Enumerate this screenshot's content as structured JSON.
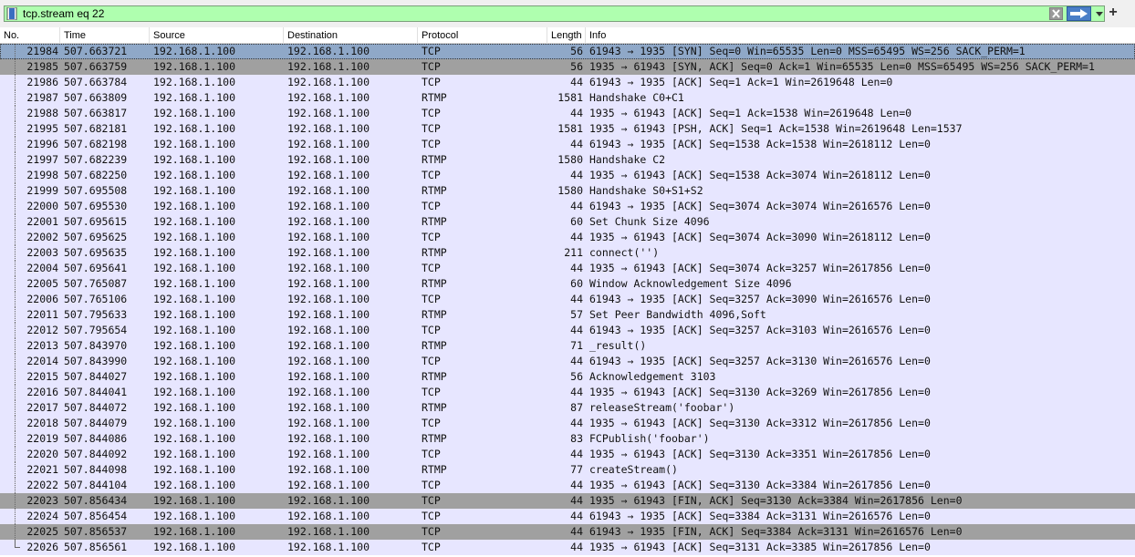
{
  "filter": {
    "value": "tcp.stream eq 22"
  },
  "toolbar": {
    "add_label": "+"
  },
  "columns": {
    "no": "No.",
    "time": "Time",
    "source": "Source",
    "destination": "Destination",
    "protocol": "Protocol",
    "length": "Length",
    "info": "Info"
  },
  "colors": {
    "selected": "#8fa8c8",
    "syn": "#a0a0a0",
    "fin": "#a0a0a0",
    "normal": "#e7e6ff",
    "filter_ok": "#afffaf"
  },
  "packets": [
    {
      "no": "21984",
      "time": "507.663721",
      "src": "192.168.1.100",
      "dst": "192.168.1.100",
      "proto": "TCP",
      "len": "56",
      "info": "61943 → 1935 [SYN] Seq=0 Win=65535 Len=0 MSS=65495 WS=256 SACK_PERM=1",
      "style": "selected"
    },
    {
      "no": "21985",
      "time": "507.663759",
      "src": "192.168.1.100",
      "dst": "192.168.1.100",
      "proto": "TCP",
      "len": "56",
      "info": "1935 → 61943 [SYN, ACK] Seq=0 Ack=1 Win=65535 Len=0 MSS=65495 WS=256 SACK_PERM=1",
      "style": "syn"
    },
    {
      "no": "21986",
      "time": "507.663784",
      "src": "192.168.1.100",
      "dst": "192.168.1.100",
      "proto": "TCP",
      "len": "44",
      "info": "61943 → 1935 [ACK] Seq=1 Ack=1 Win=2619648 Len=0",
      "style": "normal"
    },
    {
      "no": "21987",
      "time": "507.663809",
      "src": "192.168.1.100",
      "dst": "192.168.1.100",
      "proto": "RTMP",
      "len": "1581",
      "info": "Handshake C0+C1",
      "style": "normal"
    },
    {
      "no": "21988",
      "time": "507.663817",
      "src": "192.168.1.100",
      "dst": "192.168.1.100",
      "proto": "TCP",
      "len": "44",
      "info": "1935 → 61943 [ACK] Seq=1 Ack=1538 Win=2619648 Len=0",
      "style": "normal"
    },
    {
      "no": "21995",
      "time": "507.682181",
      "src": "192.168.1.100",
      "dst": "192.168.1.100",
      "proto": "TCP",
      "len": "1581",
      "info": "1935 → 61943 [PSH, ACK] Seq=1 Ack=1538 Win=2619648 Len=1537",
      "style": "normal"
    },
    {
      "no": "21996",
      "time": "507.682198",
      "src": "192.168.1.100",
      "dst": "192.168.1.100",
      "proto": "TCP",
      "len": "44",
      "info": "61943 → 1935 [ACK] Seq=1538 Ack=1538 Win=2618112 Len=0",
      "style": "normal"
    },
    {
      "no": "21997",
      "time": "507.682239",
      "src": "192.168.1.100",
      "dst": "192.168.1.100",
      "proto": "RTMP",
      "len": "1580",
      "info": "Handshake C2",
      "style": "normal"
    },
    {
      "no": "21998",
      "time": "507.682250",
      "src": "192.168.1.100",
      "dst": "192.168.1.100",
      "proto": "TCP",
      "len": "44",
      "info": "1935 → 61943 [ACK] Seq=1538 Ack=3074 Win=2618112 Len=0",
      "style": "normal"
    },
    {
      "no": "21999",
      "time": "507.695508",
      "src": "192.168.1.100",
      "dst": "192.168.1.100",
      "proto": "RTMP",
      "len": "1580",
      "info": "Handshake S0+S1+S2",
      "style": "normal"
    },
    {
      "no": "22000",
      "time": "507.695530",
      "src": "192.168.1.100",
      "dst": "192.168.1.100",
      "proto": "TCP",
      "len": "44",
      "info": "61943 → 1935 [ACK] Seq=3074 Ack=3074 Win=2616576 Len=0",
      "style": "normal"
    },
    {
      "no": "22001",
      "time": "507.695615",
      "src": "192.168.1.100",
      "dst": "192.168.1.100",
      "proto": "RTMP",
      "len": "60",
      "info": "Set Chunk Size 4096",
      "style": "normal"
    },
    {
      "no": "22002",
      "time": "507.695625",
      "src": "192.168.1.100",
      "dst": "192.168.1.100",
      "proto": "TCP",
      "len": "44",
      "info": "1935 → 61943 [ACK] Seq=3074 Ack=3090 Win=2618112 Len=0",
      "style": "normal"
    },
    {
      "no": "22003",
      "time": "507.695635",
      "src": "192.168.1.100",
      "dst": "192.168.1.100",
      "proto": "RTMP",
      "len": "211",
      "info": "connect('')",
      "style": "normal"
    },
    {
      "no": "22004",
      "time": "507.695641",
      "src": "192.168.1.100",
      "dst": "192.168.1.100",
      "proto": "TCP",
      "len": "44",
      "info": "1935 → 61943 [ACK] Seq=3074 Ack=3257 Win=2617856 Len=0",
      "style": "normal"
    },
    {
      "no": "22005",
      "time": "507.765087",
      "src": "192.168.1.100",
      "dst": "192.168.1.100",
      "proto": "RTMP",
      "len": "60",
      "info": "Window Acknowledgement Size 4096",
      "style": "normal"
    },
    {
      "no": "22006",
      "time": "507.765106",
      "src": "192.168.1.100",
      "dst": "192.168.1.100",
      "proto": "TCP",
      "len": "44",
      "info": "61943 → 1935 [ACK] Seq=3257 Ack=3090 Win=2616576 Len=0",
      "style": "normal"
    },
    {
      "no": "22011",
      "time": "507.795633",
      "src": "192.168.1.100",
      "dst": "192.168.1.100",
      "proto": "RTMP",
      "len": "57",
      "info": "Set Peer Bandwidth 4096,Soft",
      "style": "normal"
    },
    {
      "no": "22012",
      "time": "507.795654",
      "src": "192.168.1.100",
      "dst": "192.168.1.100",
      "proto": "TCP",
      "len": "44",
      "info": "61943 → 1935 [ACK] Seq=3257 Ack=3103 Win=2616576 Len=0",
      "style": "normal"
    },
    {
      "no": "22013",
      "time": "507.843970",
      "src": "192.168.1.100",
      "dst": "192.168.1.100",
      "proto": "RTMP",
      "len": "71",
      "info": "_result()",
      "style": "normal"
    },
    {
      "no": "22014",
      "time": "507.843990",
      "src": "192.168.1.100",
      "dst": "192.168.1.100",
      "proto": "TCP",
      "len": "44",
      "info": "61943 → 1935 [ACK] Seq=3257 Ack=3130 Win=2616576 Len=0",
      "style": "normal"
    },
    {
      "no": "22015",
      "time": "507.844027",
      "src": "192.168.1.100",
      "dst": "192.168.1.100",
      "proto": "RTMP",
      "len": "56",
      "info": "Acknowledgement 3103",
      "style": "normal"
    },
    {
      "no": "22016",
      "time": "507.844041",
      "src": "192.168.1.100",
      "dst": "192.168.1.100",
      "proto": "TCP",
      "len": "44",
      "info": "1935 → 61943 [ACK] Seq=3130 Ack=3269 Win=2617856 Len=0",
      "style": "normal"
    },
    {
      "no": "22017",
      "time": "507.844072",
      "src": "192.168.1.100",
      "dst": "192.168.1.100",
      "proto": "RTMP",
      "len": "87",
      "info": "releaseStream('foobar')",
      "style": "normal"
    },
    {
      "no": "22018",
      "time": "507.844079",
      "src": "192.168.1.100",
      "dst": "192.168.1.100",
      "proto": "TCP",
      "len": "44",
      "info": "1935 → 61943 [ACK] Seq=3130 Ack=3312 Win=2617856 Len=0",
      "style": "normal"
    },
    {
      "no": "22019",
      "time": "507.844086",
      "src": "192.168.1.100",
      "dst": "192.168.1.100",
      "proto": "RTMP",
      "len": "83",
      "info": "FCPublish('foobar')",
      "style": "normal"
    },
    {
      "no": "22020",
      "time": "507.844092",
      "src": "192.168.1.100",
      "dst": "192.168.1.100",
      "proto": "TCP",
      "len": "44",
      "info": "1935 → 61943 [ACK] Seq=3130 Ack=3351 Win=2617856 Len=0",
      "style": "normal"
    },
    {
      "no": "22021",
      "time": "507.844098",
      "src": "192.168.1.100",
      "dst": "192.168.1.100",
      "proto": "RTMP",
      "len": "77",
      "info": "createStream()",
      "style": "normal"
    },
    {
      "no": "22022",
      "time": "507.844104",
      "src": "192.168.1.100",
      "dst": "192.168.1.100",
      "proto": "TCP",
      "len": "44",
      "info": "1935 → 61943 [ACK] Seq=3130 Ack=3384 Win=2617856 Len=0",
      "style": "normal"
    },
    {
      "no": "22023",
      "time": "507.856434",
      "src": "192.168.1.100",
      "dst": "192.168.1.100",
      "proto": "TCP",
      "len": "44",
      "info": "1935 → 61943 [FIN, ACK] Seq=3130 Ack=3384 Win=2617856 Len=0",
      "style": "fin"
    },
    {
      "no": "22024",
      "time": "507.856454",
      "src": "192.168.1.100",
      "dst": "192.168.1.100",
      "proto": "TCP",
      "len": "44",
      "info": "61943 → 1935 [ACK] Seq=3384 Ack=3131 Win=2616576 Len=0",
      "style": "normal"
    },
    {
      "no": "22025",
      "time": "507.856537",
      "src": "192.168.1.100",
      "dst": "192.168.1.100",
      "proto": "TCP",
      "len": "44",
      "info": "61943 → 1935 [FIN, ACK] Seq=3384 Ack=3131 Win=2616576 Len=0",
      "style": "fin"
    },
    {
      "no": "22026",
      "time": "507.856561",
      "src": "192.168.1.100",
      "dst": "192.168.1.100",
      "proto": "TCP",
      "len": "44",
      "info": "1935 → 61943 [ACK] Seq=3131 Ack=3385 Win=2617856 Len=0",
      "style": "normal"
    }
  ]
}
